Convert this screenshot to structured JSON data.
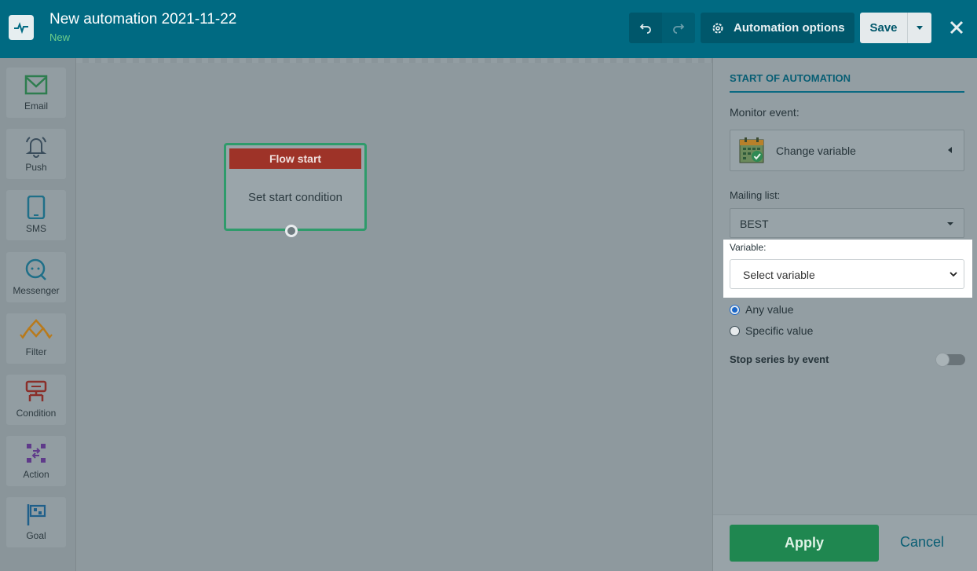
{
  "header": {
    "title": "New automation 2021-11-22",
    "status": "New",
    "options_label": "Automation options",
    "save_label": "Save"
  },
  "sidebar": {
    "tools": [
      {
        "label": "Email",
        "icon": "envelope-icon"
      },
      {
        "label": "Push",
        "icon": "bell-icon"
      },
      {
        "label": "SMS",
        "icon": "phone-icon"
      },
      {
        "label": "Messenger",
        "icon": "chat-icon"
      },
      {
        "label": "Filter",
        "icon": "filter-icon"
      },
      {
        "label": "Condition",
        "icon": "condition-icon"
      },
      {
        "label": "Action",
        "icon": "action-icon"
      },
      {
        "label": "Goal",
        "icon": "flag-icon"
      }
    ]
  },
  "canvas": {
    "node": {
      "header": "Flow start",
      "body": "Set start condition"
    }
  },
  "panel": {
    "title": "START OF AUTOMATION",
    "monitor_label": "Monitor event:",
    "event_value": "Change variable",
    "mailing_list_label": "Mailing list:",
    "mailing_list_value": "BEST",
    "variable_label": "Variable:",
    "variable_placeholder": "Select variable",
    "radio_any": "Any value",
    "radio_specific": "Specific value",
    "stop_series_label": "Stop series by event",
    "apply_label": "Apply",
    "cancel_label": "Cancel"
  },
  "colors": {
    "header_bg": "#006a82",
    "apply_green": "#1f8750",
    "flow_start_red": "#9e3328",
    "accent_teal": "#085e74"
  }
}
